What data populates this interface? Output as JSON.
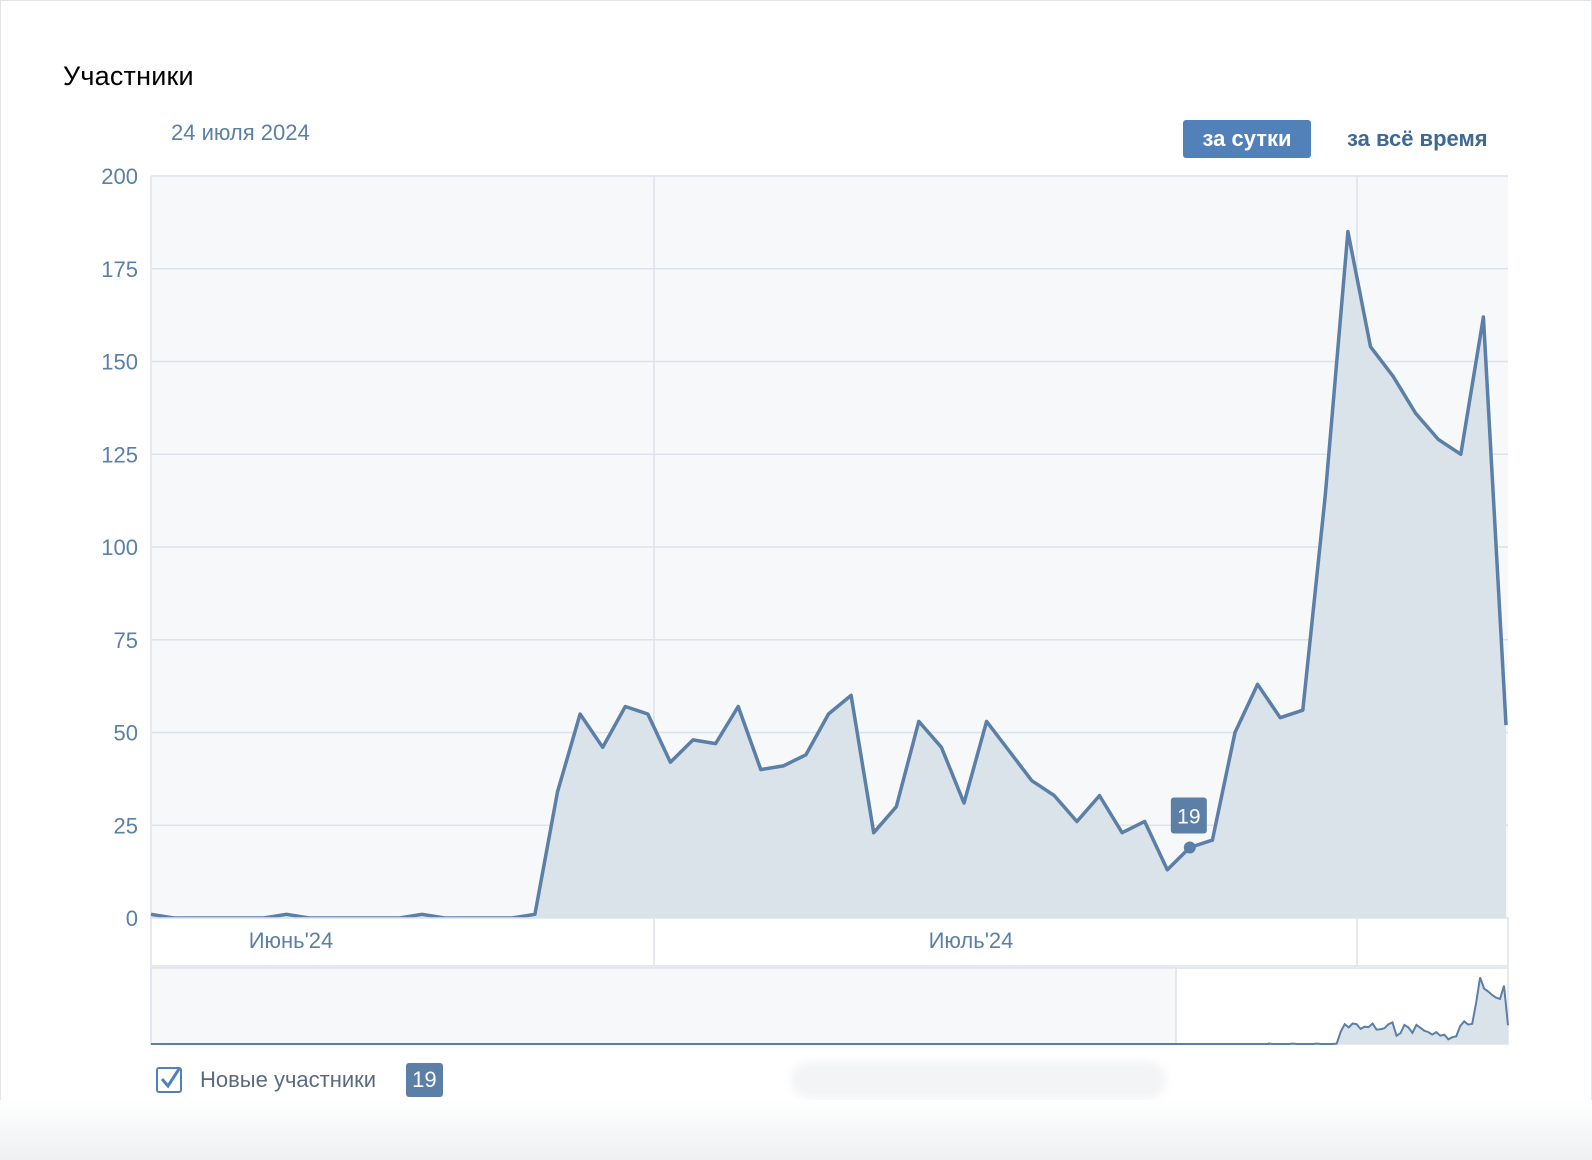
{
  "title": "Участники",
  "date_label": "24 июля 2024",
  "period_buttons": [
    {
      "label": "за сутки",
      "active": true
    },
    {
      "label": "за всё время",
      "active": false
    }
  ],
  "legend": {
    "label": "Новые участники",
    "value": "19",
    "checked": true
  },
  "colors": {
    "line": "#5b7fa6",
    "area": "#dae2ea",
    "plot_bg": "#f7f8fa",
    "grid": "#dde3ea",
    "accent": "#5181b8",
    "tick_text": "#5b80a5"
  },
  "chart_data": {
    "type": "area",
    "title": "Участники",
    "xlabel": "",
    "ylabel": "",
    "ylim": [
      0,
      200
    ],
    "yticks": [
      0,
      25,
      50,
      75,
      100,
      125,
      150,
      175,
      200
    ],
    "x_tick_labels": [
      "Июнь'24",
      "Июль'24"
    ],
    "grid": true,
    "legend": "bottom-left",
    "tooltip": {
      "index": 46,
      "value": 19
    },
    "series": [
      {
        "name": "Новые участники",
        "values": [
          1,
          0,
          0,
          0,
          0,
          0,
          1,
          0,
          0,
          0,
          0,
          0,
          1,
          0,
          0,
          0,
          0,
          1,
          34,
          55,
          46,
          57,
          55,
          42,
          48,
          47,
          57,
          40,
          41,
          44,
          55,
          60,
          23,
          30,
          53,
          46,
          31,
          53,
          45,
          37,
          33,
          26,
          33,
          23,
          26,
          13,
          19,
          21,
          50,
          63,
          54,
          56,
          114,
          185,
          154,
          146,
          136,
          129,
          125,
          162,
          52
        ]
      }
    ]
  }
}
